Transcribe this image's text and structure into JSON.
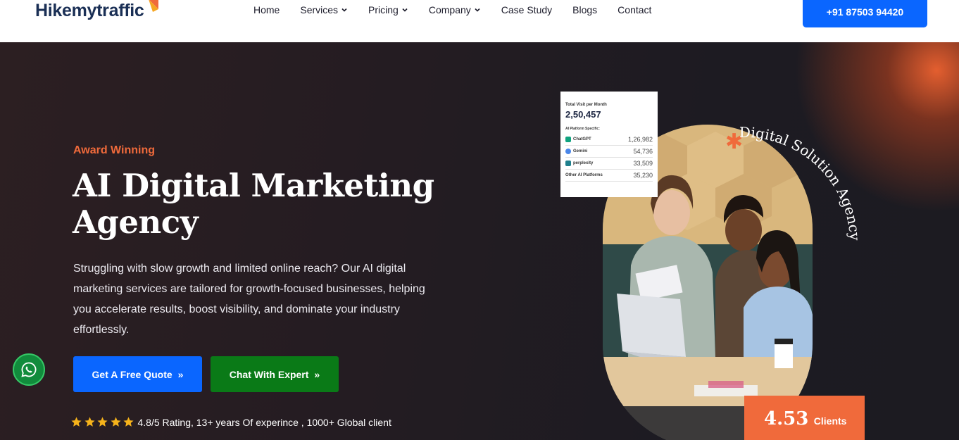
{
  "header": {
    "logo_text": "Hikemytraffic",
    "nav": [
      {
        "label": "Home",
        "has_dropdown": false
      },
      {
        "label": "Services",
        "has_dropdown": true
      },
      {
        "label": "Pricing",
        "has_dropdown": true
      },
      {
        "label": "Company",
        "has_dropdown": true
      },
      {
        "label": "Case Study",
        "has_dropdown": false
      },
      {
        "label": "Blogs",
        "has_dropdown": false
      },
      {
        "label": "Contact",
        "has_dropdown": false
      }
    ],
    "phone_button": "+91 87503 94420"
  },
  "hero": {
    "eyebrow": "Award Winning",
    "title_line1": "AI Digital Marketing",
    "title_line2": "Agency",
    "description": "Struggling with slow growth and limited online reach? Our AI digital marketing services are tailored for growth-focused businesses, helping you accelerate results, boost visibility, and dominate your industry effortlessly.",
    "cta_quote": "Get A Free Quote",
    "cta_chat": "Chat With Expert",
    "cta_arrows": "»",
    "rating_stars": 5,
    "rating_text": "4.8/5 Rating, 13+ years Of experince , 1000+ Global client"
  },
  "stats_card": {
    "title": "Total Visit per Month",
    "total": "2,50,457",
    "subtitle": "AI Platform Specific:",
    "rows": [
      {
        "label": "ChatGPT",
        "value": "1,26,982"
      },
      {
        "label": "Gemini",
        "value": "54,736"
      },
      {
        "label": "perplexity",
        "value": "33,509"
      },
      {
        "label": "Other AI Platforms",
        "value": "35,230"
      }
    ]
  },
  "badge": {
    "asterisk": "✱",
    "curved_text": "Digital Solution Agency"
  },
  "clients_box": {
    "number": "4.53",
    "label": "Clients"
  },
  "colors": {
    "accent_orange": "#f06a3b",
    "primary_blue": "#0a66ff",
    "chat_green": "#0a7a17",
    "navy": "#1a2f55"
  },
  "icons": {
    "nav_dropdown": "chevron-down-icon",
    "star": "star-icon",
    "whatsapp": "whatsapp-icon",
    "logo_mark": "arrow-up-right-icon"
  }
}
